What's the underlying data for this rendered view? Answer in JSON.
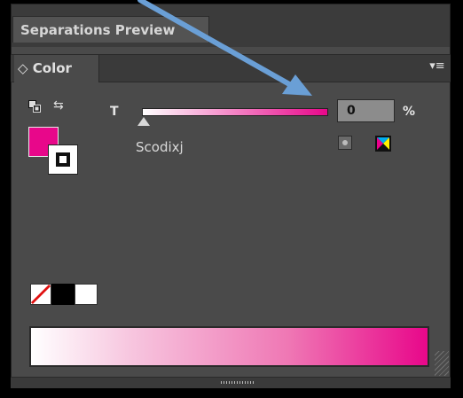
{
  "panel": {
    "separations_tab_label": "Separations Preview",
    "color_tab": {
      "chevron_glyph": "◇",
      "label": "Color"
    },
    "menu_icon_glyph": "▾≡"
  },
  "controls": {
    "swap_icon_glyph": "⇆",
    "tint_label": "T",
    "tint_value": "0",
    "percent_label": "%",
    "swatch_name": "Scodixj",
    "fill_color": "#e8078a",
    "stroke_color": "#ffffff"
  },
  "icons": {
    "default_fill_stroke": "default-fill-stroke-icon",
    "swap": "swap-fill-stroke-icon",
    "spot_color": "spot-color-icon",
    "process_color": "process-color-icon"
  },
  "colors": {
    "accent": "#e8078a",
    "panel_bg": "#4a4a4a",
    "annotation_arrow": "#6a9fd6"
  }
}
